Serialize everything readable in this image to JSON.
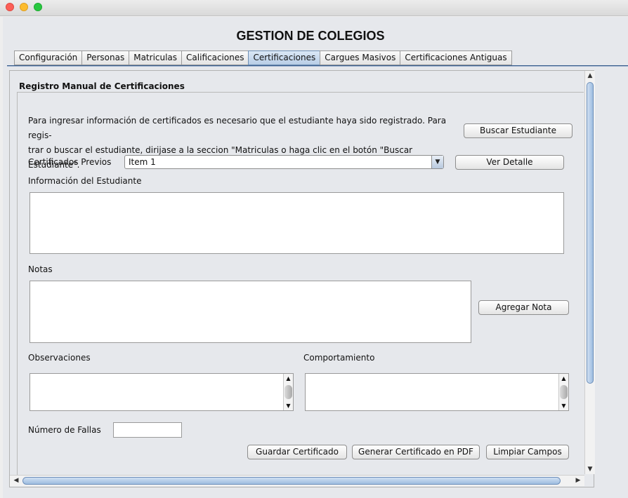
{
  "window": {
    "title": "GESTION DE COLEGIOS"
  },
  "tabs": [
    {
      "label": "Configuración"
    },
    {
      "label": "Personas"
    },
    {
      "label": "Matriculas"
    },
    {
      "label": "Calificaciones"
    },
    {
      "label": "Certificaciones",
      "active": true
    },
    {
      "label": "Cargues Masivos"
    },
    {
      "label": "Certificaciones Antiguas"
    }
  ],
  "section": {
    "title": "Registro Manual de Certificaciones",
    "intro_line1": "Para ingresar información de certificados es necesario que el estudiante haya sido registrado. Para regis-",
    "intro_line2": "trar o buscar el estudiante, dirijase a la seccion \"Matriculas o haga clic en el botón \"Buscar Estudiante\".",
    "buscar_button": "Buscar Estudiante",
    "certificados_label": "Certificados Previos",
    "certificados_selected": "Item 1",
    "ver_detalle_button": "Ver Detalle",
    "info_label": "Información del Estudiante",
    "notas_label": "Notas",
    "agregar_nota_button": "Agregar Nota",
    "observaciones_label": "Observaciones",
    "comportamiento_label": "Comportamiento",
    "fallas_label": "Número de Fallas",
    "fallas_value": "",
    "guardar_button": "Guardar Certificado",
    "pdf_button": "Generar Certificado en PDF",
    "limpiar_button": "Limpiar Campos"
  },
  "icons": {
    "scroll_up": "scroll-up-arrow-icon",
    "scroll_down": "scroll-down-arrow-icon",
    "dropdown": "chevron-down-icon"
  }
}
